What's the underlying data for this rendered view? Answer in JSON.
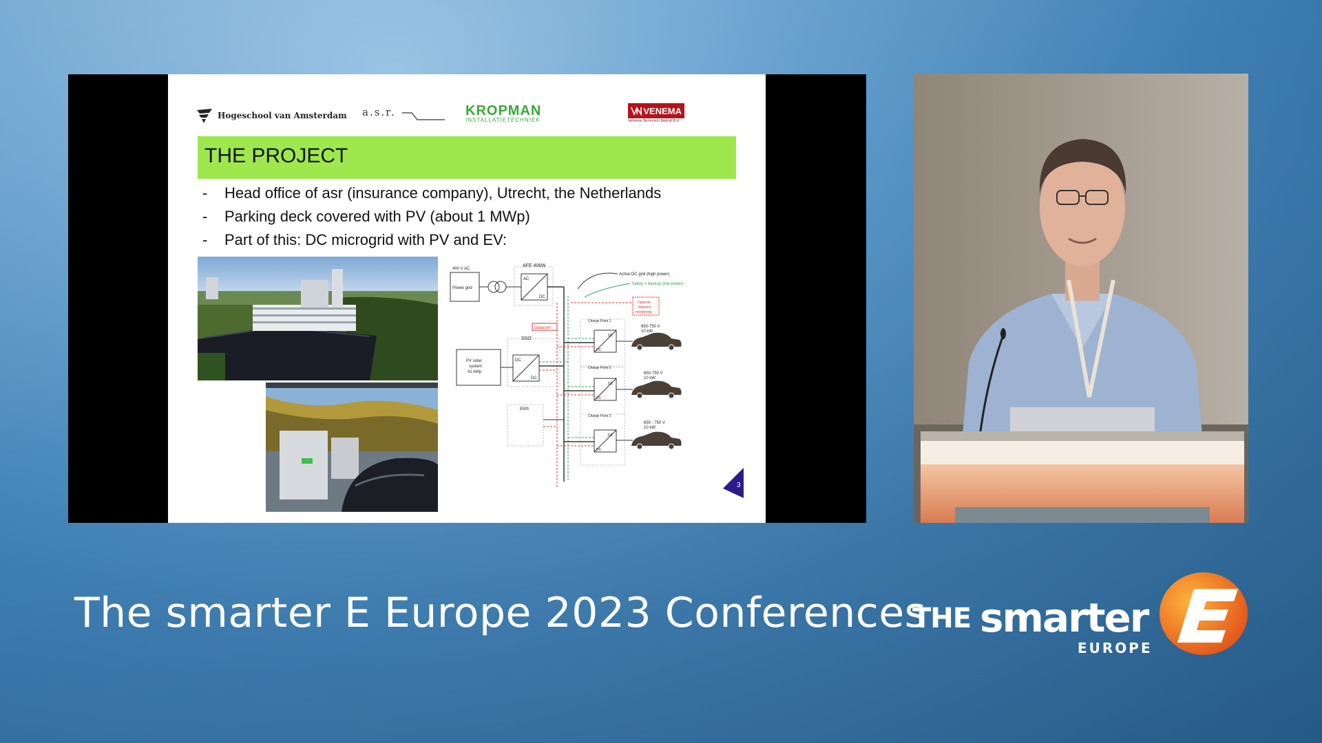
{
  "slide": {
    "logos": {
      "hva": "Hogeschool van Amsterdam",
      "asr": "a.s.r.",
      "kropman_main": "KROPMAN",
      "kropman_sub": "INSTALLATIETECHNIEK",
      "venema_main": "VENEMA",
      "venema_sub": "Venema Technisch Bedrijf B.V."
    },
    "title": "THE PROJECT",
    "bullets": [
      "Head office of asr (insurance company), Utrecht, the Netherlands",
      "Parking deck covered with PV (about 1 MWp)",
      "Part of this: DC microgrid with PV and EV:"
    ],
    "bullet_marker": "-",
    "diagram": {
      "grid_voltage": "400 V AC",
      "power_grid": "Power grid",
      "afe": "AFE  40kW",
      "ac": "AC",
      "dc": "DC",
      "active_dc_grid": "Active DC grid (high power)",
      "safety_low_power": "Safety + backup (low power)",
      "optional_network_monitoring": [
        "Optional",
        "Network",
        "monitoring"
      ],
      "datacom": "Datacom",
      "sso": "SSO",
      "pv_system": [
        "PV solar",
        "system",
        "41 kWp"
      ],
      "ems": "EMS",
      "charge_points": [
        {
          "label": "Charge Point 1",
          "voltage": "650-750 V",
          "power": "10 kW"
        },
        {
          "label": "Charge Point 2",
          "voltage": "650-750 V",
          "power": "10 kW"
        },
        {
          "label": "Charge Point 3",
          "voltage": "650 - 750 V",
          "power": "10 kW"
        }
      ]
    },
    "page_number": "3",
    "colors": {
      "title_bar": "#9ee84e",
      "page_badge": "#2a1a8c",
      "kropman": "#3aa935",
      "venema": "#b5121b"
    }
  },
  "banner": {
    "conference_title": "The smarter E Europe 2023 Conferences",
    "brand_the": "THE",
    "brand_smarter": "smarter",
    "brand_europe": "EUROPE",
    "brand_e_color": "#f28a1e"
  }
}
